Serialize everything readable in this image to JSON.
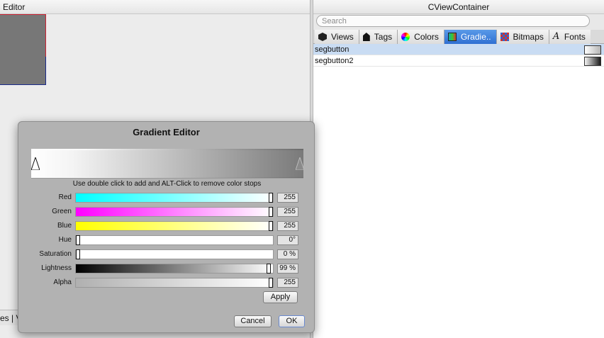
{
  "left_panel": {
    "title": "Editor",
    "bottom_text": "es | V"
  },
  "right_panel": {
    "title": "CViewContainer",
    "search": {
      "placeholder": "Search",
      "value": ""
    },
    "tabs": [
      {
        "label": "Views",
        "icon": "cube-icon",
        "active": false
      },
      {
        "label": "Tags",
        "icon": "tag-icon",
        "active": false
      },
      {
        "label": "Colors",
        "icon": "color-wheel-icon",
        "active": false
      },
      {
        "label": "Gradie..",
        "icon": "gradient-icon",
        "active": true
      },
      {
        "label": "Bitmaps",
        "icon": "bitmap-icon",
        "active": false
      },
      {
        "label": "Fonts",
        "icon": "font-icon",
        "active": false
      }
    ],
    "items": [
      {
        "name": "segbutton",
        "selected": true
      },
      {
        "name": "segbutton2",
        "selected": false
      }
    ]
  },
  "dialog": {
    "title": "Gradient Editor",
    "hint": "Use double click to add and ALT-Click to remove color stops",
    "sliders": {
      "red": {
        "label": "Red",
        "value": "255",
        "level": 1.0
      },
      "green": {
        "label": "Green",
        "value": "255",
        "level": 1.0
      },
      "blue": {
        "label": "Blue",
        "value": "255",
        "level": 1.0
      },
      "hue": {
        "label": "Hue",
        "value": "0°",
        "level": 0.0
      },
      "saturation": {
        "label": "Saturation",
        "value": "0 %",
        "level": 0.0
      },
      "lightness": {
        "label": "Lightness",
        "value": "99 %",
        "level": 0.99
      },
      "alpha": {
        "label": "Alpha",
        "value": "255",
        "level": 1.0
      }
    },
    "apply_label": "Apply",
    "cancel_label": "Cancel",
    "ok_label": "OK"
  },
  "colors": {
    "active_tab": "#3a7bdc",
    "selected_row": "#c9dcf3",
    "dialog_bg": "#b2b2b2"
  }
}
